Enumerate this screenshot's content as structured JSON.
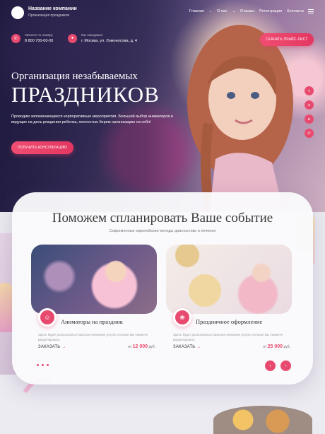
{
  "header": {
    "company_name": "Название компании",
    "company_sub": "Организация праздников",
    "nav": [
      "Главная",
      "О нас",
      "Отзывы",
      "Регистрация",
      "Контакты"
    ],
    "nav_icons": {
      "1": "chevron-down-icon"
    }
  },
  "contacts": {
    "phone_label": "Звоните по номеру",
    "phone": "8 800 700-00-00",
    "address_label": "Мы находимся",
    "address": "г. Москва, ул. Ломоносова, д. 4"
  },
  "price_button": "СКАЧАТЬ ПРАЙС-ЛИСТ",
  "hero": {
    "title_line1": "Организация незабываемых",
    "title_line2": "ПРАЗДНИКОВ",
    "text": "Проводим запоминающиеся корпоративные мероприятия. Большой выбор аниматоров и ведущих на день рождения ребенка, полностью берем организацию на себя!",
    "button": "ПОЛУЧИТЬ КОНСУЛЬТАЦИЮ"
  },
  "social_icons": [
    "vk-icon",
    "ok-icon",
    "telegram-icon",
    "whatsapp-icon"
  ],
  "services_section": {
    "title": "Поможем спланировать Ваше событие",
    "subtitle": "Современные европейские методы диагностики и лечения",
    "items": [
      {
        "name": "Аниматоры на праздник",
        "description": "Здесь будет располагаться краткое описание услуги, которое Вы сможете редактировать",
        "order_label": "ЗАКАЗАТЬ",
        "price_prefix": "от",
        "price": "12 000",
        "price_unit": "руб."
      },
      {
        "name": "Праздничное оформление",
        "description": "Здесь будет располагаться краткое описание услуги, которое Вы сможете редактировать",
        "order_label": "ЗАКАЗАТЬ",
        "price_prefix": "от",
        "price": "25 000",
        "price_unit": "руб."
      }
    ]
  },
  "colors": {
    "accent": "#e84a6f",
    "hero_dark": "#2c2a52",
    "card_bg": "#fafafc"
  }
}
